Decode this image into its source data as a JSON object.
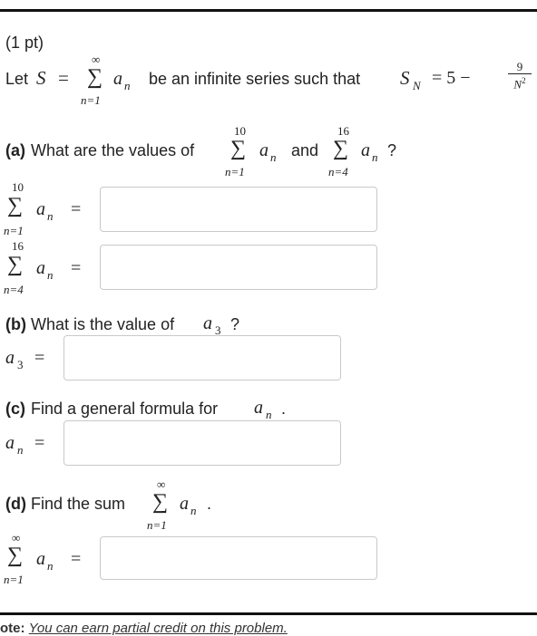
{
  "header": {
    "points": "(1 pt)"
  },
  "intro": {
    "let": "Let",
    "S": "S",
    "eq": "=",
    "sum_upper": "∞",
    "sum_lower": "n=1",
    "a": "a",
    "sub_n": "n",
    "text": "be an infinite series such that",
    "SN": "S",
    "SN_sub": "N",
    "eq2": "= 5 −",
    "frac_num": "9",
    "frac_den": "N",
    "frac_den_exp": "2"
  },
  "part_a": {
    "label": "(a)",
    "text": "What are the values of",
    "and": "and",
    "q": "?",
    "sum1_upper": "10",
    "sum1_lower": "n=1",
    "sum2_upper": "16",
    "sum2_lower": "n=4",
    "a": "a",
    "sub_n": "n",
    "eq": "=",
    "input1_value": "",
    "input2_value": ""
  },
  "part_b": {
    "label": "(b)",
    "text": "What is the value of",
    "a": "a",
    "sub": "3",
    "q": "?",
    "eq": "=",
    "input_value": ""
  },
  "part_c": {
    "label": "(c)",
    "text": "Find a general formula for",
    "a": "a",
    "sub": "n",
    "period": ".",
    "eq": "=",
    "input_value": ""
  },
  "part_d": {
    "label": "(d)",
    "text": "Find the sum",
    "sum_upper": "∞",
    "sum_lower": "n=1",
    "a": "a",
    "sub": "n",
    "period": ".",
    "eq": "=",
    "input_value": ""
  },
  "footer": {
    "note_label": "ote:",
    "note_text": "You can earn partial credit on this problem."
  }
}
